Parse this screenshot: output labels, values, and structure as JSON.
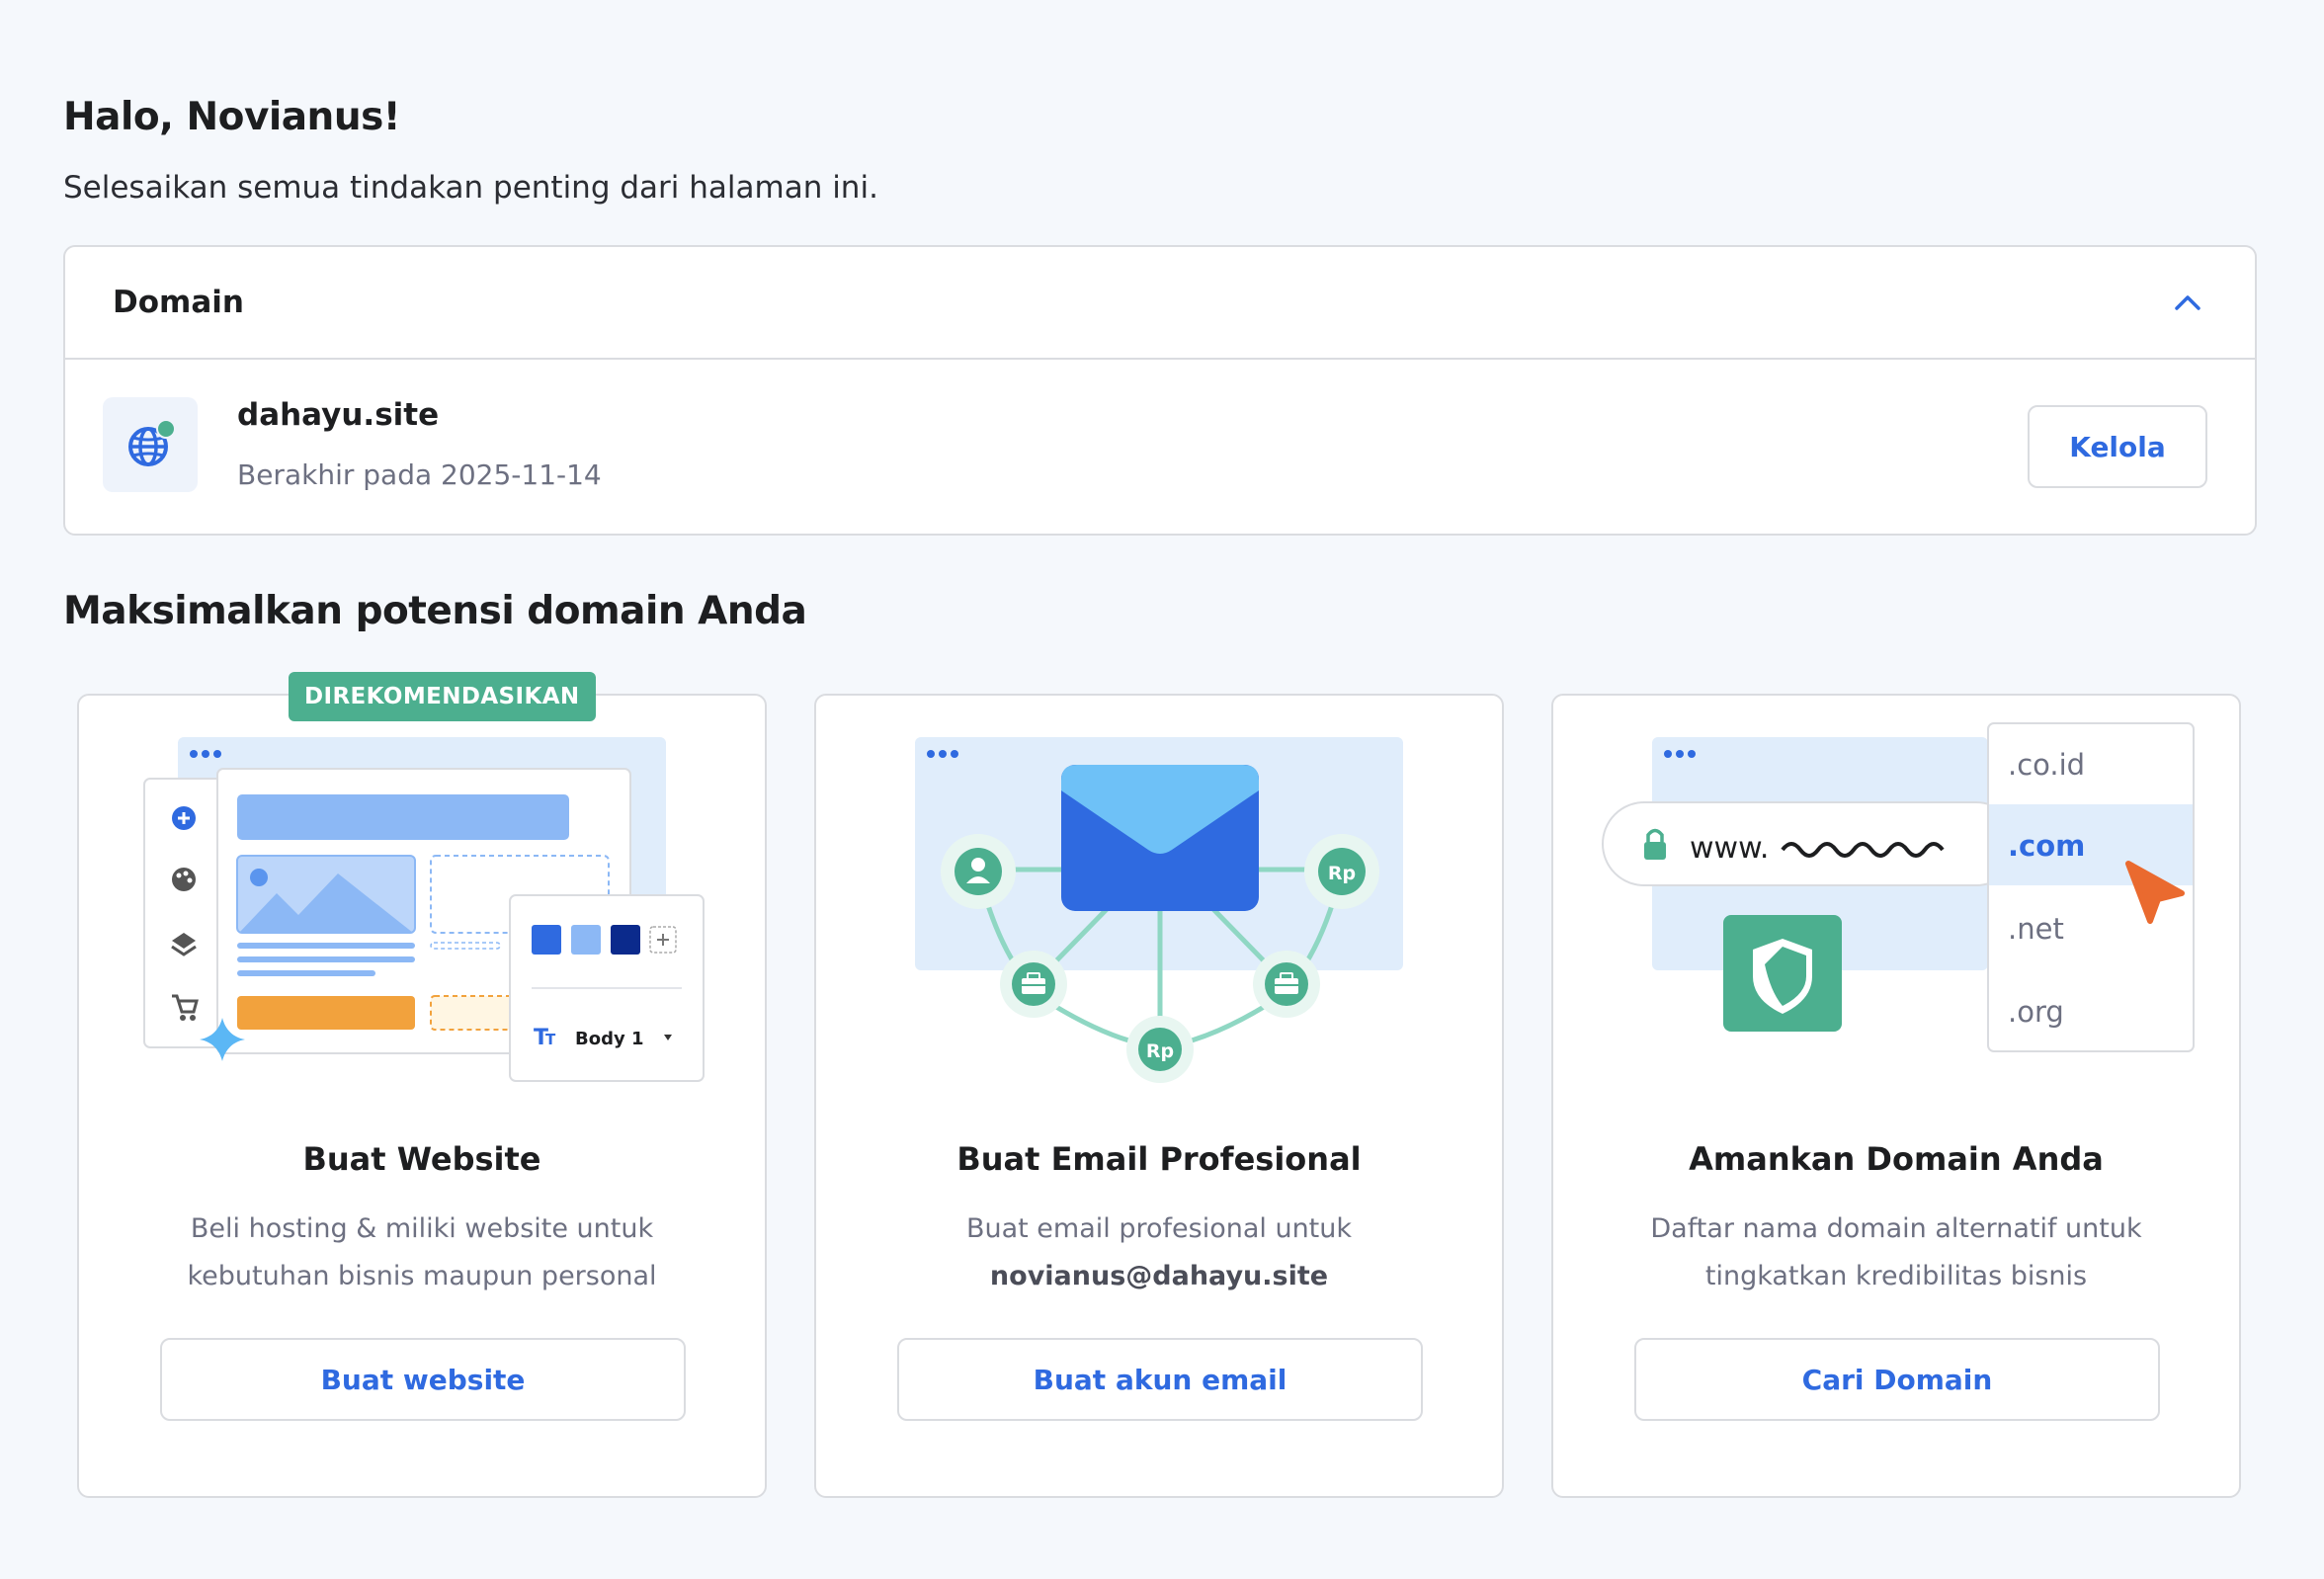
{
  "greeting": "Halo, Novianus!",
  "subtitle": "Selesaikan semua tindakan penting dari halaman ini.",
  "domain_panel": {
    "title": "Domain",
    "item": {
      "name": "dahayu.site",
      "expiry": "Berakhir pada 2025-11-14",
      "manage_label": "Kelola"
    }
  },
  "section_title": "Maksimalkan potensi domain Anda",
  "cards": [
    {
      "badge": "DIREKOMENDASIKAN",
      "title": "Buat Website",
      "desc_line1": "Beli hosting & miliki website untuk",
      "desc_line2": "kebutuhan bisnis maupun personal",
      "button": "Buat website",
      "illus_text": "Body 1"
    },
    {
      "title": "Buat Email Profesional",
      "desc_line1": "Buat email profesional untuk",
      "desc_line2": "novianus@dahayu.site",
      "button": "Buat akun email",
      "illus_text": "Rp"
    },
    {
      "title": "Amankan Domain Anda",
      "desc_line1": "Daftar nama domain alternatif untuk",
      "desc_line2": "tingkatkan kredibilitas bisnis",
      "button": "Cari Domain",
      "illus_www": "www.",
      "illus_tlds": [
        ".co.id",
        ".com",
        ".net",
        ".org"
      ]
    }
  ],
  "colors": {
    "accent": "#2f6ae0",
    "badge": "#4caf8f",
    "background": "#f5f8fc",
    "border": "#dadce0",
    "muted_text": "#6d7081"
  },
  "icons": [
    "globe-icon",
    "chevron-up-icon",
    "plus-circle-icon",
    "palette-icon",
    "layers-icon",
    "cart-icon",
    "envelope-icon",
    "user-icon",
    "briefcase-icon",
    "lock-icon",
    "shield-icon",
    "cursor-icon"
  ]
}
